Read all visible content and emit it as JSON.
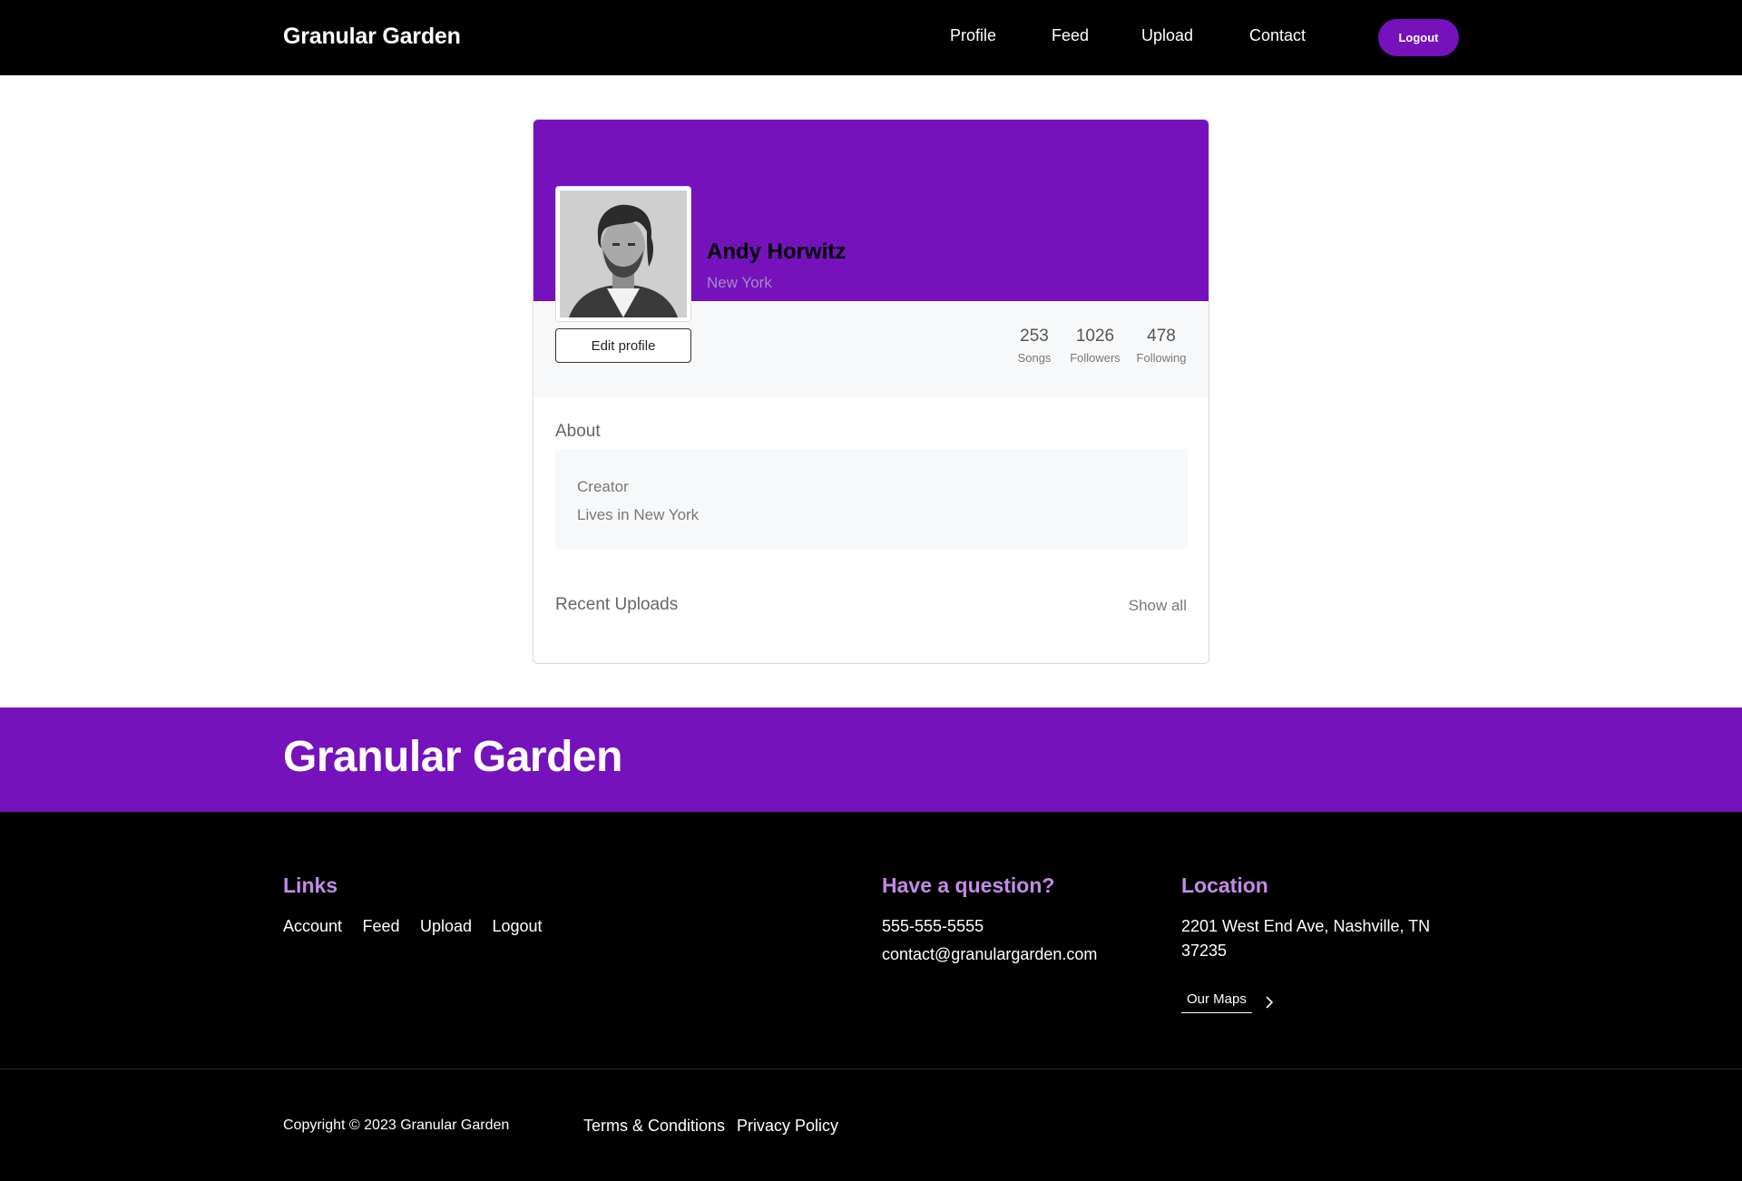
{
  "nav": {
    "brand": "Granular Garden",
    "links": [
      "Profile",
      "Feed",
      "Upload",
      "Contact"
    ],
    "logout_label": "Logout"
  },
  "profile": {
    "name": "Andy Horwitz",
    "location": "New York",
    "edit_label": "Edit profile",
    "stats": [
      {
        "value": "253",
        "label": "Songs"
      },
      {
        "value": "1026",
        "label": "Followers"
      },
      {
        "value": "478",
        "label": "Following"
      }
    ],
    "about_title": "About",
    "about_lines": [
      "Creator",
      "Lives in New York"
    ],
    "recent_title": "Recent Uploads",
    "show_all_label": "Show all"
  },
  "footer": {
    "brand": "Granular Garden",
    "links_heading": "Links",
    "links": [
      "Account",
      "Feed",
      "Upload",
      "Logout"
    ],
    "question_heading": "Have a question?",
    "phone": "555-555-5555",
    "email": "contact@granulargarden.com",
    "location_heading": "Location",
    "address": "2201 West End Ave, Nashville, TN 37235",
    "maps_label": "Our Maps",
    "copyright": "Copyright © 2023 Granular Garden",
    "terms": "Terms & Conditions",
    "privacy": "Privacy Policy"
  },
  "colors": {
    "accent": "#7512bb",
    "footer_heading": "#c38be6",
    "background_dark": "#000000"
  },
  "icons": [
    "chevron-right-icon",
    "avatar-photo"
  ]
}
